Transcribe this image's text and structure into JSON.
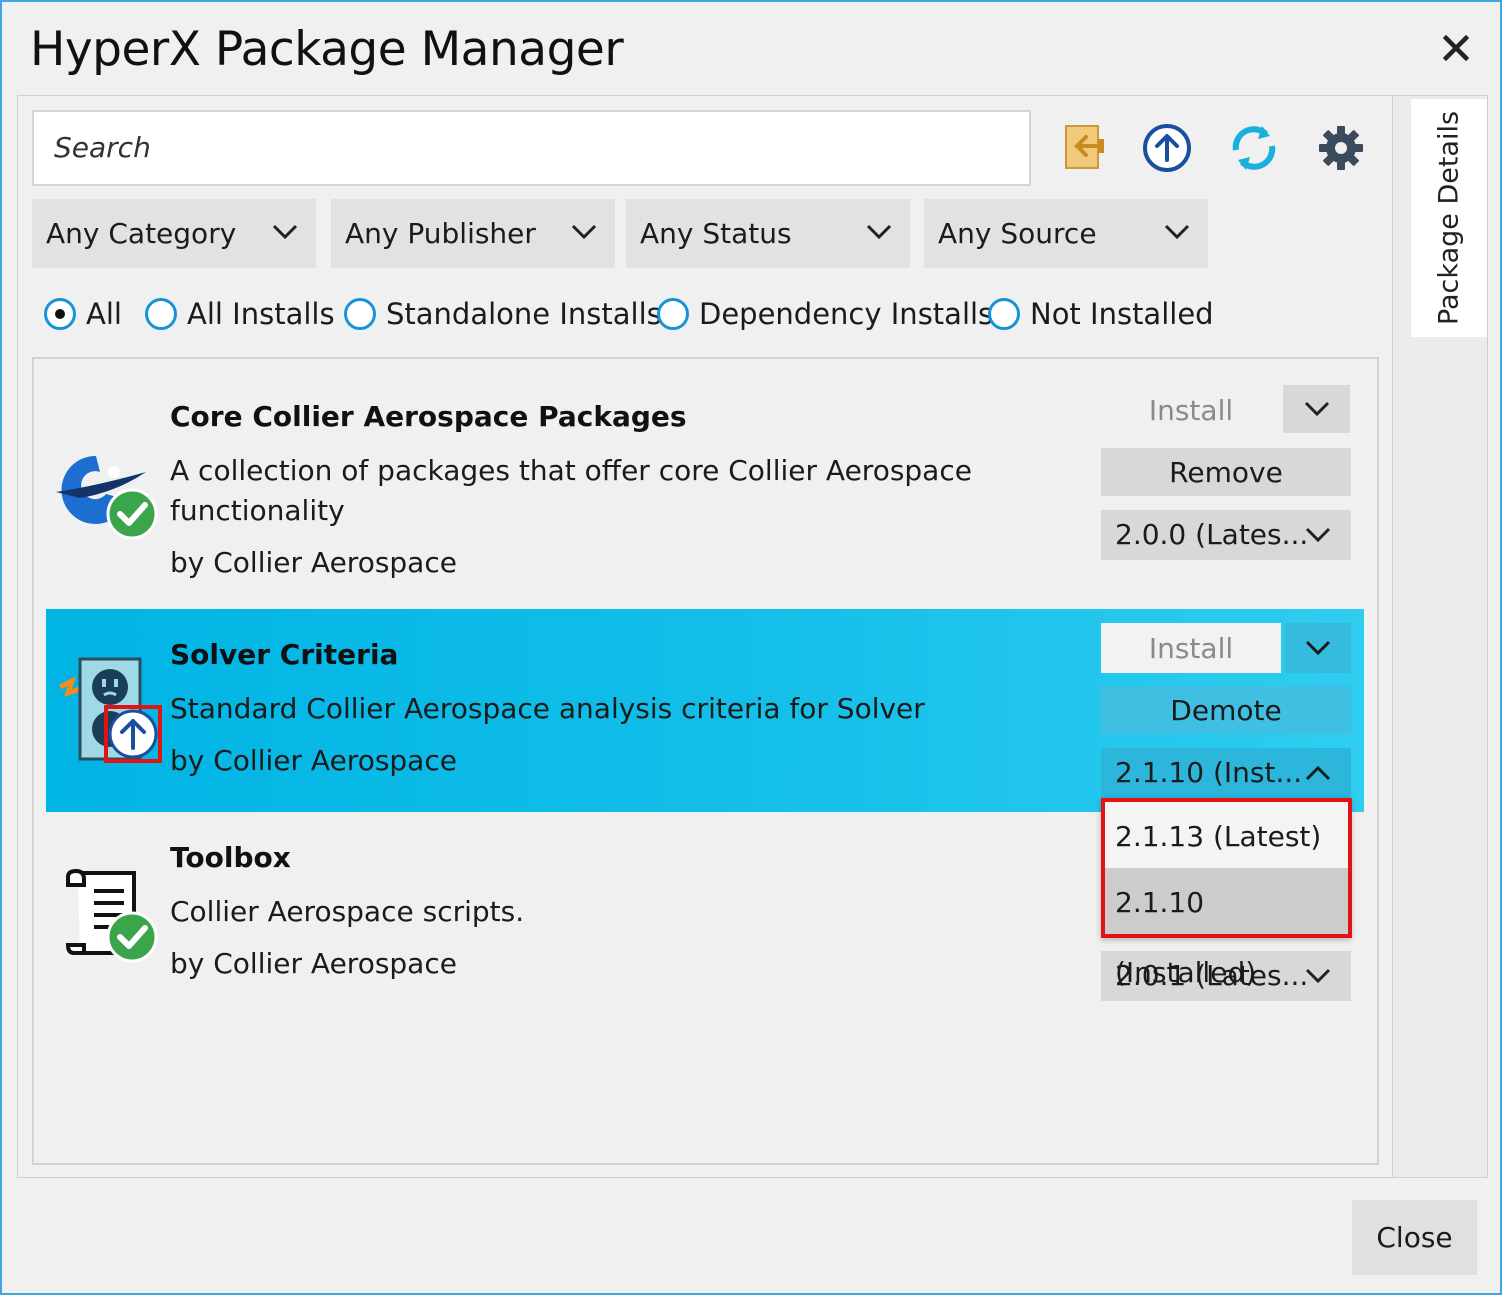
{
  "window": {
    "title": "HyperX Package Manager"
  },
  "search": {
    "placeholder": "Search"
  },
  "toolbar": {
    "icons": [
      "import-icon",
      "upgrade-all-icon",
      "refresh-icon",
      "settings-icon"
    ]
  },
  "side_tab": {
    "label": "Package Details"
  },
  "filters": [
    "Any Category",
    "Any Publisher",
    "Any Status",
    "Any Source"
  ],
  "install_filter": {
    "options": [
      "All",
      "All Installs",
      "Standalone Installs",
      "Dependency Installs",
      "Not Installed"
    ],
    "selected": "All"
  },
  "packages": [
    {
      "title": "Core Collier Aerospace Packages",
      "description_line1": "A collection of packages that offer core Collier Aerospace",
      "description_line2": "functionality",
      "publisher": "by Collier Aerospace",
      "install_label": "Install",
      "action_label": "Remove",
      "version": "2.0.0 (Lates...",
      "status_icon": "installed-check-icon"
    },
    {
      "title": "Solver Criteria",
      "description": "Standard Collier Aerospace analysis criteria for Solver",
      "publisher": "by Collier Aerospace",
      "install_label": "Install",
      "action_label": "Demote",
      "version": "2.1.10 (Inst...",
      "status_icon": "update-available-icon",
      "version_options": [
        "2.1.13 (Latest)",
        "2.1.10 (Installed)"
      ]
    },
    {
      "title": "Toolbox",
      "description": "Collier Aerospace scripts.",
      "publisher": "by Collier Aerospace",
      "version": "2.0.1 (Lates...",
      "status_icon": "installed-check-icon"
    }
  ],
  "footer": {
    "close_label": "Close"
  },
  "colors": {
    "selected_row": "#00b4e4",
    "accent": "#1a93d6",
    "highlight": "#e21313",
    "check_green": "#3aa54a"
  }
}
